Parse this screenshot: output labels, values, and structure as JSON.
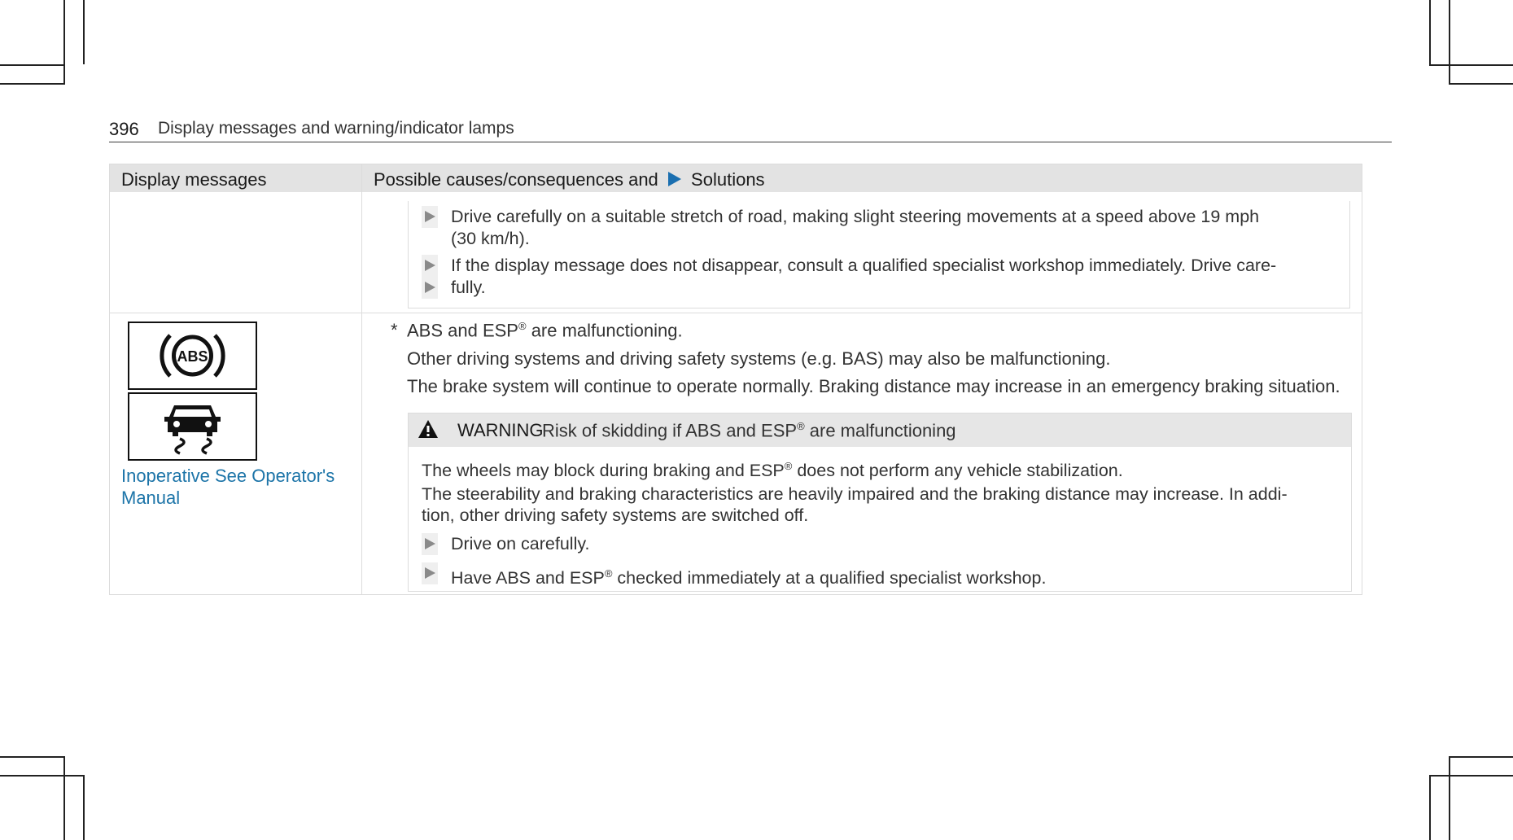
{
  "page": {
    "number": "396",
    "section_title": "Display messages and warning/indicator lamps"
  },
  "table": {
    "col_display": "Display messages",
    "col_causes_prefix": "Possible causes/consequences and",
    "col_causes_suffix": "Solutions",
    "row1_steps": [
      "Drive carefully on a suitable stretch of road, making slight steering movements at a speed above 19 mph",
      "(30 km/h).",
      "If the display message does not disappear, consult a qualified specialist workshop immediately. Drive care-",
      "fully."
    ],
    "row2": {
      "display_icons": [
        "abs-warning-icon",
        "skid-esp-icon"
      ],
      "display_message_line1": "Inoperative See Operator's",
      "display_message_line2": "Manual",
      "asterisk": "*",
      "cause_a": "ABS and ESP",
      "cause_b": " are malfunctioning.",
      "cause_2": "Other driving systems and driving safety systems (e.g. BAS) may also be malfunctioning.",
      "cause_3": "The brake system will continue to operate normally. Braking distance may increase in an emergency braking situation.",
      "registered": "®",
      "abs_label": "ABS",
      "warning": {
        "icon": "warning-triangle-icon",
        "label": "WARNING",
        "title_a": "Risk of skidding if ABS and ESP",
        "title_b": " are malfunctioning",
        "line1_a": "The wheels may block during braking and ESP",
        "line1_b": " does not perform any vehicle stabilization.",
        "line2": "The steerability and braking characteristics are heavily impaired and the braking distance may increase. In addi-",
        "line3": "tion, other driving safety systems are switched off.",
        "step1": "Drive on carefully.",
        "step2_a": "Have ABS and ESP",
        "step2_b": " checked immediately at a qualified specialist workshop."
      }
    }
  },
  "colors": {
    "link": "#1c74a8",
    "solutions_arrow": "#1a6fb0",
    "header_bg": "#e3e3e3"
  }
}
